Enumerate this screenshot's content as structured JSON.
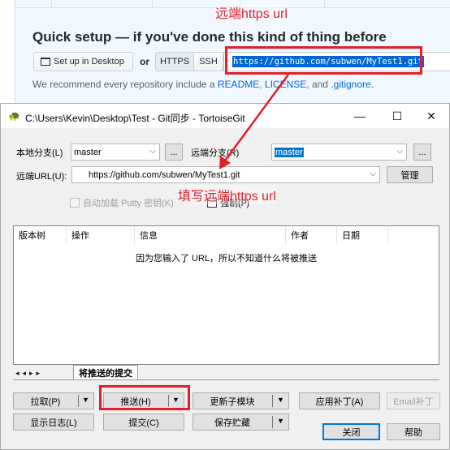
{
  "github": {
    "title": "Quick setup — if you've done this kind of thing before",
    "desktop_button": "Set up in Desktop",
    "or_label": "or",
    "https_tab": "HTTPS",
    "ssh_tab": "SSH",
    "clone_url": "https://github.com/subwen/MyTest1.git",
    "recommend_prefix": "We recommend every repository include a",
    "readme": "README",
    "comma": ",",
    "license": "LICENSE",
    "and": ", and",
    "gitignore": ".gitignore",
    "period": "."
  },
  "annotations": {
    "remote_url_note": "远端https url",
    "fill_note": "填写远端https url",
    "red_color": "#e0202a"
  },
  "dialog": {
    "title": "C:\\Users\\Kevin\\Desktop\\Test - Git同步 - TortoiseGit",
    "minimize": "—",
    "maximize": "☐",
    "close": "✕",
    "local_branch_label": "本地分支(L)",
    "local_branch_value": "master",
    "ellipsis": "...",
    "remote_branch_label": "远端分支(R)",
    "remote_branch_value": "master",
    "remote_url_label": "远端URL(U):",
    "remote_url_value": "https://github.com/subwen/MyTest1.git",
    "manage_button": "管理",
    "autoload_putty": "自动加载 Putty 密钥(K)",
    "force": "强制(F)",
    "columns": [
      "版本树",
      "操作",
      "信息",
      "作者",
      "日期"
    ],
    "list_message": "因为您输入了 URL，所以不知道什么将被推送",
    "tab_nav": "◂◂▸▸",
    "tab_label": "将推送的提交",
    "pull_button": "拉取(P)",
    "push_button": "推送(H)",
    "update_submodule_button": "更新子模块",
    "apply_patch_button": "应用补丁(A)",
    "email_patch_button": "Email补丁",
    "show_log_button": "显示日志(L)",
    "commit_button": "提交(C)",
    "stash_button": "保存贮藏",
    "close_button": "关闭",
    "help_button": "帮助",
    "dropdown_arrow": "▼",
    "combo_arrow": "⌵"
  }
}
